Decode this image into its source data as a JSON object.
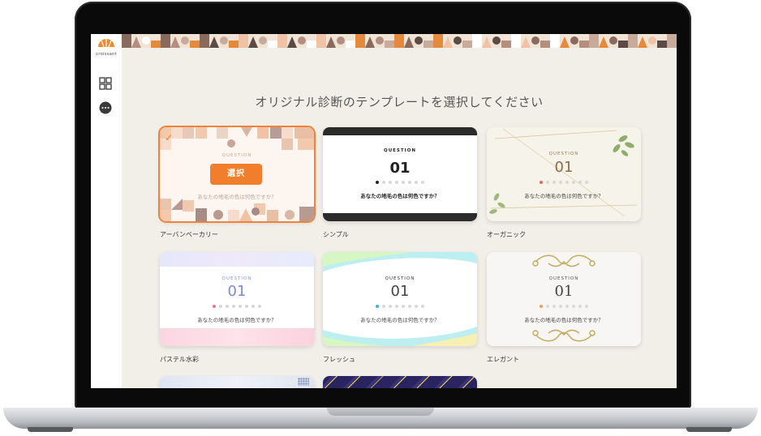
{
  "app": {
    "logo_text": "croissant"
  },
  "sidebar": {
    "items": [
      {
        "icon": "grid-icon"
      },
      {
        "icon": "chat-icon"
      }
    ]
  },
  "page": {
    "title": "オリジナル診断のテンプレートを選択してください"
  },
  "templates": [
    {
      "name": "アーバンベーカリー",
      "question_label": "QUESTION",
      "number": "",
      "text": "あなたの地毛の色は何色ですか？",
      "selected": true,
      "select_label": "選択"
    },
    {
      "name": "シンプル",
      "question_label": "QUESTION",
      "number": "01",
      "text": "あなたの地毛の色は何色ですか？",
      "selected": false
    },
    {
      "name": "オーガニック",
      "question_label": "QUESTION",
      "number": "01",
      "text": "あなたの地毛の色は何色ですか？",
      "selected": false
    },
    {
      "name": "パステル水彩",
      "question_label": "QUESTION",
      "number": "01",
      "text": "あなたの地毛の色は何色ですか？",
      "selected": false
    },
    {
      "name": "フレッシュ",
      "question_label": "QUESTION",
      "number": "01",
      "text": "あなたの地毛の色は何色ですか？",
      "selected": false
    },
    {
      "name": "エレガント",
      "question_label": "QUESTION",
      "number": "01",
      "text": "あなたの地毛の色は何色ですか？",
      "selected": false
    }
  ],
  "colors": {
    "accent": "#f07e2a",
    "screen_bg": "#f2efe9"
  }
}
